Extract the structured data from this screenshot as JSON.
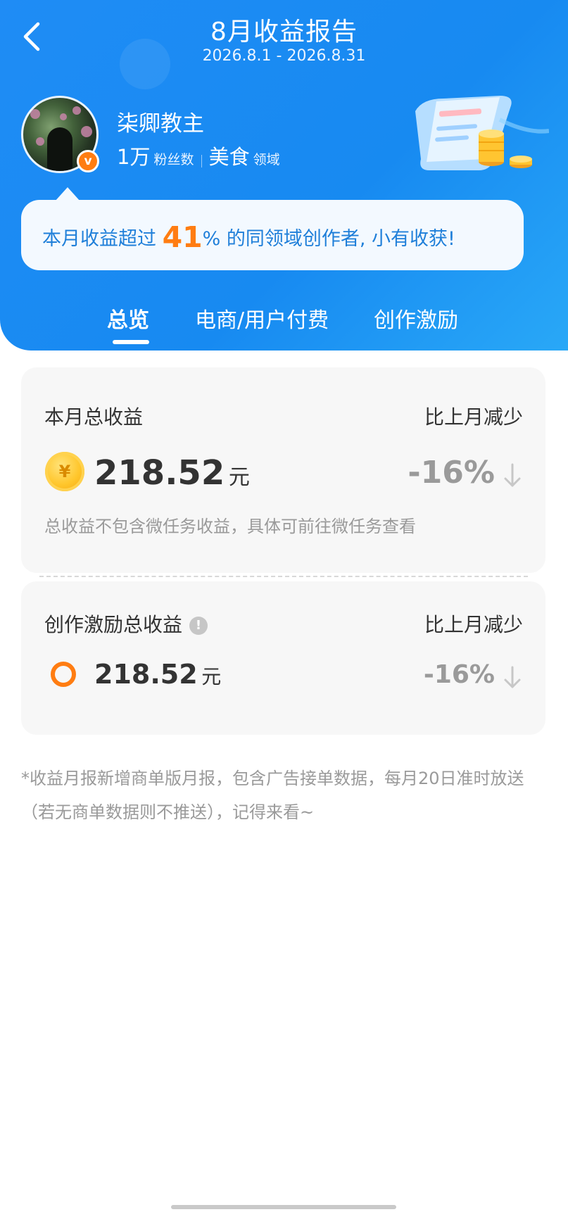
{
  "header": {
    "title": "8月收益报告",
    "date_range": "2026.8.1 - 2026.8.31"
  },
  "profile": {
    "name": "柒卿教主",
    "fans_count": "1万",
    "fans_label": "粉丝数",
    "field_value": "美食",
    "field_label": "领域",
    "verified_badge": "v"
  },
  "tip": {
    "prefix": "本月收益超过 ",
    "percent": "41",
    "suffix": "% 的同领域创作者, 小有收获!"
  },
  "tabs": [
    {
      "label": "总览",
      "active": true
    },
    {
      "label": "电商/用户付费",
      "active": false
    },
    {
      "label": "创作激励",
      "active": false
    }
  ],
  "total_card": {
    "label": "本月总收益",
    "compare_label": "比上月减少",
    "coin_symbol": "¥",
    "amount": "218.52",
    "unit": "元",
    "change": "-16%",
    "note": "总收益不包含微任务收益，具体可前往微任务查看"
  },
  "incentive_card": {
    "label": "创作激励总收益",
    "info_symbol": "!",
    "compare_label": "比上月减少",
    "amount": "218.52",
    "unit": "元",
    "change": "-16%"
  },
  "footnote": "*收益月报新增商单版月报，包含广告接单数据，每月20日准时放送（若无商单数据则不推送），记得来看~",
  "colors": {
    "header_blue": "#178af1",
    "accent_orange": "#ff7d12",
    "tip_text_blue": "#1f7fd9",
    "muted_gray": "#9a9a9a"
  }
}
